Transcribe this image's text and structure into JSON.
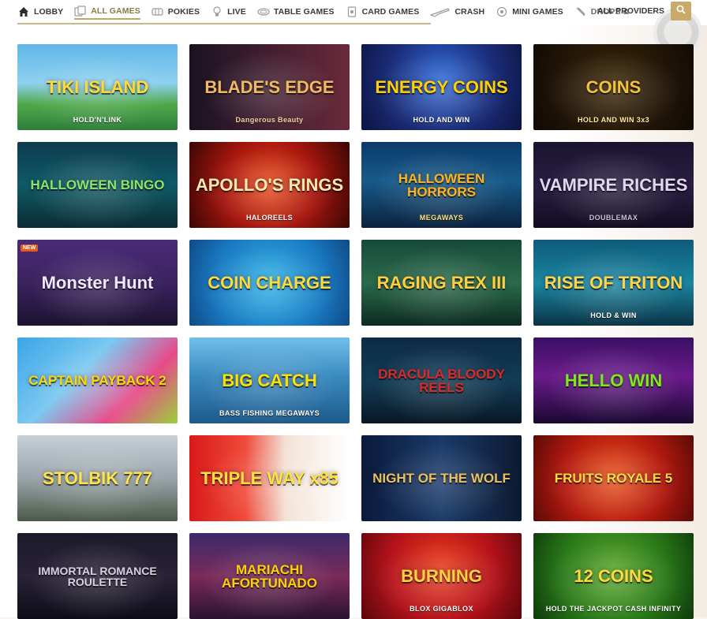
{
  "nav": {
    "items": [
      {
        "label": "LOBBY",
        "icon": "house-icon"
      },
      {
        "label": "ALL GAMES",
        "icon": "cards-icon",
        "active": true
      },
      {
        "label": "POKIES",
        "icon": "slot-machine-icon"
      },
      {
        "label": "LIVE",
        "icon": "lightbulb-icon"
      },
      {
        "label": "TABLE GAMES",
        "icon": "table-icon"
      },
      {
        "label": "CARD GAMES",
        "icon": "playing-card-icon"
      },
      {
        "label": "CRASH",
        "icon": "plane-icon"
      },
      {
        "label": "MINI GAMES",
        "icon": "joystick-icon"
      },
      {
        "label": "DROPS &",
        "icon": "drops-icon"
      }
    ],
    "providers_label": "ALL PROVIDERS",
    "search_icon": "search-icon"
  },
  "games": [
    {
      "title": "TIKI ISLAND",
      "sub": "HOLD'N'LINK",
      "bg": "linear-gradient(180deg,#5fb6e8 0%,#8ed1f0 45%,#4fa84a 70%,#2f7e3a 100%)",
      "title_color": "#ffd83a",
      "sub_color": "#ffffff"
    },
    {
      "title": "BLADE'S EDGE",
      "sub": "Dangerous Beauty",
      "bg": "linear-gradient(90deg,#1a1220 0%,#3a1c2e 40%,#6a2a3a 100%)",
      "title_color": "#f0b860",
      "sub_color": "#f3d2a0"
    },
    {
      "title": "ENERGY COINS",
      "sub": "HOLD AND WIN",
      "bg": "radial-gradient(circle at 50% 40%,#2f6ad8 0%,#1b2d7a 55%,#0c1440 100%)",
      "title_color": "#ffd000",
      "sub_color": "#ffffff"
    },
    {
      "title": "COINS",
      "sub": "HOLD AND WIN 3x3",
      "bg": "radial-gradient(circle at 50% 45%,#3a2608 0%,#1c1206 70%,#100a03 100%)",
      "title_color": "#f2c23a",
      "sub_color": "#ffe9a0"
    },
    {
      "title": "HALLOWEEN BINGO",
      "sub": "",
      "bg": "linear-gradient(180deg,#0d3b4e 0%,#0f5a66 50%,#0b2c34 100%)",
      "title_color": "#8be36a",
      "sub_color": "#ffffff"
    },
    {
      "title": "APOLLO'S RINGS",
      "sub": "HALOREELS",
      "bg": "radial-gradient(circle at 50% 50%,#e84c1c 0%,#a8160e 50%,#3a0704 100%)",
      "title_color": "#ffe7b0",
      "sub_color": "#ffffff"
    },
    {
      "title": "HALLOWEEN HORRORS",
      "sub": "MEGAWAYS",
      "bg": "linear-gradient(180deg,#0b3a6a 0%,#175a8a 45%,#0b223e 100%)",
      "title_color": "#ffb21a",
      "sub_color": "#ffe27a"
    },
    {
      "title": "VAMPIRE RICHES",
      "sub": "DOUBLEMAX",
      "bg": "linear-gradient(180deg,#1a1430 0%,#2a1e42 50%,#120c22 100%)",
      "title_color": "#e0d6f0",
      "sub_color": "#c8c0d8"
    },
    {
      "title": "Monster Hunt",
      "sub": "",
      "bg": "linear-gradient(180deg,#4a2a78 0%,#3a225e 50%,#1c1230 100%)",
      "title_color": "#f0e6ff",
      "sub_color": "#ffffff",
      "badge": "NEW"
    },
    {
      "title": "COIN CHARGE",
      "sub": "",
      "bg": "radial-gradient(circle at 50% 50%,#2fb2e6 0%,#1a7ac2 60%,#0f4a86 100%)",
      "title_color": "#ffd83a",
      "sub_color": "#ffffff"
    },
    {
      "title": "RAGING REX III",
      "sub": "",
      "bg": "linear-gradient(180deg,#164a3a 0%,#2a6a4a 50%,#0d2a22 100%)",
      "title_color": "#ffcf40",
      "sub_color": "#ffffff"
    },
    {
      "title": "RISE OF TRITON",
      "sub": "HOLD & WIN",
      "bg": "linear-gradient(180deg,#0e5a7a 0%,#1a86a0 50%,#0a3346 100%)",
      "title_color": "#ffd34a",
      "sub_color": "#ffffff"
    },
    {
      "title": "CAPTAIN PAYBACK 2",
      "sub": "",
      "bg": "linear-gradient(135deg,#3aa6e8 0%,#7cc8f0 40%,#e84a8a 70%,#9ad23a 100%)",
      "title_color": "#ffd700",
      "sub_color": "#ffffff"
    },
    {
      "title": "BIG CATCH",
      "sub": "BASS FISHING MEGAWAYS",
      "bg": "linear-gradient(180deg,#6fc0e8 0%,#3a8ac0 45%,#1d5a8a 100%)",
      "title_color": "#ffe000",
      "sub_color": "#ffffff"
    },
    {
      "title": "DRACULA BLOODY REELS",
      "sub": "",
      "bg": "linear-gradient(180deg,#0e2a44 0%,#123c56 50%,#081826 100%)",
      "title_color": "#d82a2a",
      "sub_color": "#ffffff"
    },
    {
      "title": "HELLO WIN",
      "sub": "",
      "bg": "linear-gradient(180deg,#3a1064 0%,#6a1a8a 45%,#1a0832 100%)",
      "title_color": "#7ee81a",
      "sub_color": "#ffffff"
    },
    {
      "title": "STOLBIK 777",
      "sub": "",
      "bg": "linear-gradient(180deg,#c7d0d6 0%,#9aa4aa 50%,#4a5a48 100%)",
      "title_color": "#ffe34a",
      "sub_color": "#ffffff"
    },
    {
      "title": "TRIPLE WAY x85",
      "sub": "",
      "bg": "linear-gradient(90deg,#d81a1a 0%,#f04a3a 35%,#f3e2d6 60%,#ffffff 100%)",
      "title_color": "#ffe040",
      "sub_color": "#ffffff"
    },
    {
      "title": "NIGHT OF THE WOLF",
      "sub": "",
      "bg": "linear-gradient(90deg,#0a1a3a 0%,#1a3a6a 50%,#0c1a30 100%)",
      "title_color": "#e8c060",
      "sub_color": "#ffffff"
    },
    {
      "title": "FRUITS ROYALE 5",
      "sub": "",
      "bg": "radial-gradient(circle at 50% 50%,#e8521a 0%,#b41a10 55%,#5a0a06 100%)",
      "title_color": "#ffd84a",
      "sub_color": "#ffffff"
    },
    {
      "title": "IMMORTAL ROMANCE ROULETTE",
      "sub": "",
      "bg": "linear-gradient(180deg,#1a1a2a 0%,#2a2238 50%,#0c0c16 100%)",
      "title_color": "#d8d0e0",
      "sub_color": "#ffffff"
    },
    {
      "title": "MARIACHI AFORTUNADO",
      "sub": "",
      "bg": "linear-gradient(180deg,#3a2a6a 0%,#7a2a5a 50%,#2a1232 100%)",
      "title_color": "#ffd000",
      "sub_color": "#ffffff"
    },
    {
      "title": "BURNING",
      "sub": "BLOX GIGABLOX",
      "bg": "radial-gradient(circle at 50% 40%,#e83a1a 0%,#b4121a 55%,#5a060c 100%)",
      "title_color": "#ffd040",
      "sub_color": "#ffffff"
    },
    {
      "title": "12 COINS",
      "sub": "HOLD THE JACKPOT CASH INFINITY",
      "bg": "radial-gradient(circle at 50% 45%,#5aa62a 0%,#2a7a1a 55%,#0e3a0a 100%)",
      "title_color": "#ffd83a",
      "sub_color": "#ffffff"
    }
  ]
}
